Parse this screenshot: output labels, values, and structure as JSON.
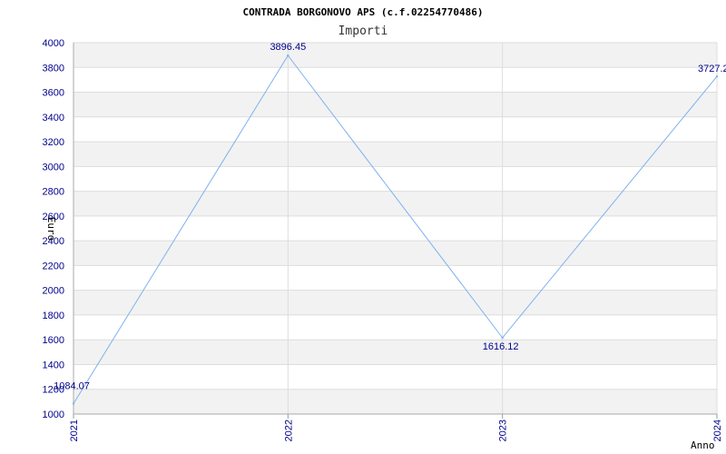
{
  "chart_data": {
    "type": "line",
    "title": "CONTRADA BORGONOVO APS (c.f.02254770486)",
    "subtitle": "Importi",
    "xlabel": "Anno",
    "ylabel": "Euro",
    "x": [
      "2021",
      "2022",
      "2023",
      "2024"
    ],
    "series": [
      {
        "values": [
          1084.07,
          3896.45,
          1616.12,
          3727.2
        ]
      }
    ],
    "data_labels": [
      "1084.07",
      "3896.45",
      "1616.12",
      "3727.2"
    ],
    "ylim": [
      1000,
      4000
    ],
    "yticks": [
      1000,
      1200,
      1400,
      1600,
      1800,
      2000,
      2200,
      2400,
      2600,
      2800,
      3000,
      3200,
      3400,
      3600,
      3800,
      4000
    ],
    "grid": true,
    "legend": "none",
    "colors": {
      "line": "#7fb2ee",
      "band": "#f2f2f2",
      "grid": "#dddddd",
      "tick_text": "#00008b"
    }
  }
}
